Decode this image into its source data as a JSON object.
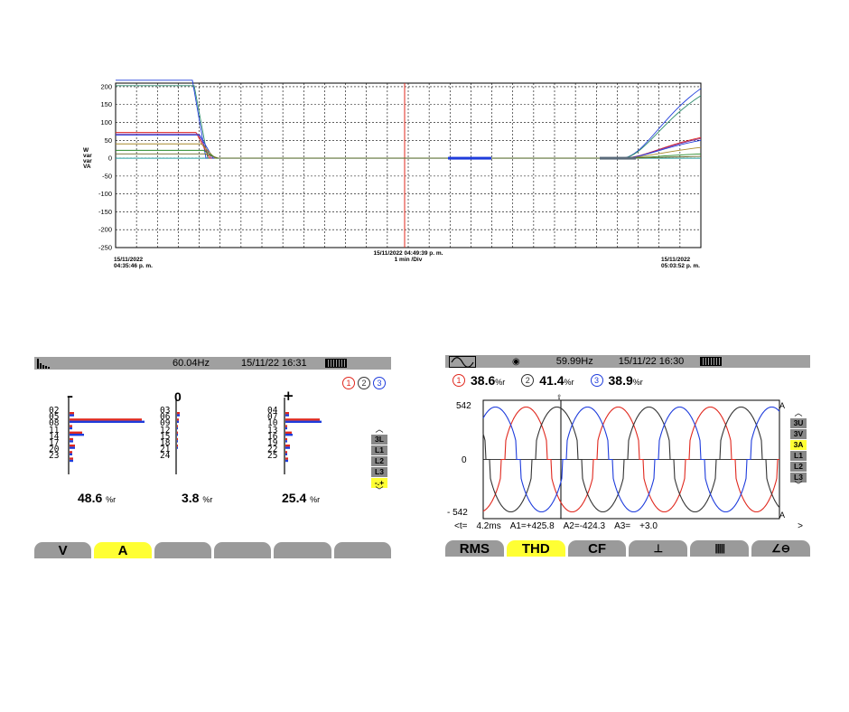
{
  "trend": {
    "y_labels": [
      "W",
      "var",
      "var",
      "VA"
    ],
    "y_ticks": [
      "200",
      "150",
      "100",
      "50",
      "0",
      "-50",
      "-100",
      "-150",
      "-200",
      "-250"
    ],
    "left_date": "15/11/2022",
    "left_time": "04:35:46 p. m.",
    "cursor_time": "15/11/2022 04:49:39 p. m.",
    "scale": "1 min /Div",
    "right_date": "15/11/2022",
    "right_time": "05:03:52 p. m."
  },
  "harmonics": {
    "frequency": "60.04Hz",
    "datetime": "15/11/22 16:31",
    "phase_sel": [
      "1",
      "2",
      "3"
    ],
    "groups": [
      {
        "sign": "–",
        "orders": [
          "02",
          "05",
          "08",
          "11",
          "14",
          "17",
          "20",
          "23"
        ],
        "value": "48.6",
        "unit": "%r"
      },
      {
        "sign": "0",
        "orders": [
          "03",
          "06",
          "09",
          "12",
          "15",
          "18",
          "21",
          "24"
        ],
        "value": "3.8",
        "unit": "%r"
      },
      {
        "sign": "+",
        "orders": [
          "04",
          "07",
          "10",
          "13",
          "16",
          "19",
          "22",
          "25"
        ],
        "value": "25.4",
        "unit": "%r"
      }
    ],
    "side_buttons": [
      "3L",
      "L1",
      "L2",
      "L3",
      "-.+"
    ],
    "tabs": [
      "V",
      "A",
      "",
      "",
      "",
      ""
    ]
  },
  "waveform": {
    "frequency": "59.99Hz",
    "datetime": "15/11/22 16:30",
    "thd": [
      {
        "phase": "1",
        "value": "38.6",
        "unit": "%r"
      },
      {
        "phase": "2",
        "value": "41.4",
        "unit": "%r"
      },
      {
        "phase": "3",
        "value": "38.9",
        "unit": "%r"
      }
    ],
    "y_top": "542",
    "y_mid": "0",
    "y_bot": "- 542",
    "axis_label": "A",
    "cursor_readout": {
      "t_label": "<t=",
      "t_value": "4.2ms",
      "a1": "A1=+425.8",
      "a2": "A2=-424.3",
      "a3_label": "A3=",
      "a3_value": "+3.0",
      "more": ">"
    },
    "side_buttons": [
      "3U",
      "3V",
      "3A",
      "L1",
      "L2",
      "L3"
    ],
    "tabs": [
      "RMS",
      "THD",
      "CF",
      "",
      "",
      ""
    ]
  },
  "colors": {
    "phase1": "#e0281e",
    "phase2": "#333333",
    "phase3": "#1e3cdc",
    "select": "#ffff33",
    "tab": "#9a9a9a"
  }
}
